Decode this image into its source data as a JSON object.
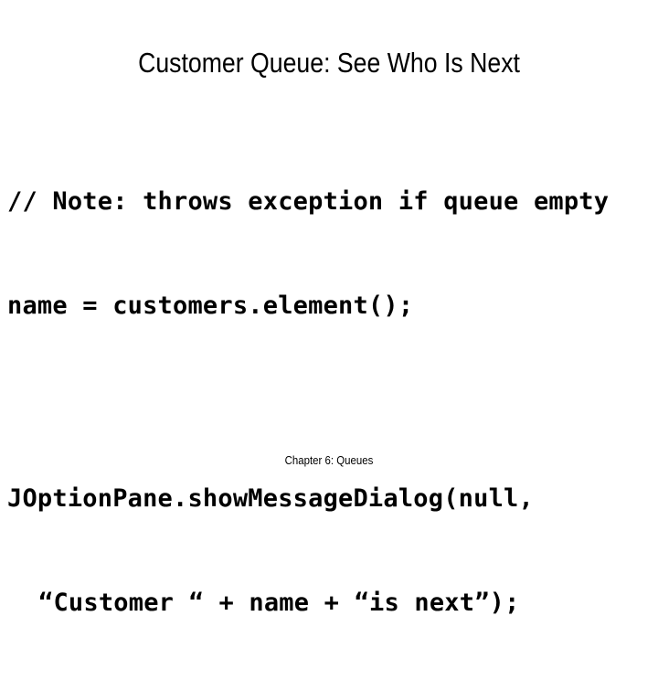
{
  "slide": {
    "title": "Customer Queue: See Who Is Next",
    "background_color": "#ffffff",
    "text_color": "#000000",
    "footer": "Chapter 6: Queues",
    "code": {
      "language": "java",
      "lines": [
        {
          "text": "// Note: throws exception if queue empty",
          "indent": false,
          "blank": false
        },
        {
          "text": "name = customers.element();",
          "indent": false,
          "blank": false
        },
        {
          "text": "",
          "indent": false,
          "blank": true
        },
        {
          "text": "JOptionPane.showMessageDialog(null,",
          "indent": false,
          "blank": false
        },
        {
          "text": "“Customer “ + name + “is next”);",
          "indent": true,
          "blank": false
        }
      ]
    }
  }
}
